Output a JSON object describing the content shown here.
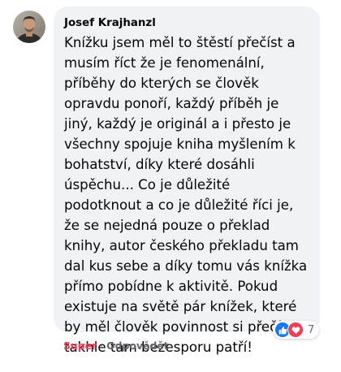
{
  "comment": {
    "author": "Josef Krajhanzl",
    "text_lines": [
      "Knížku jsem měl to štěstí přečíst a",
      "musím říct že je fenomenální,",
      "příběhy do kterých se člověk",
      "opravdu ponoří, každý příběh je",
      "jiný, každý je originál a i přesto je",
      "všechny spojuje kniha myšlením k",
      "bohatství, díky které dosáhli",
      "úspěchu... Co je důležité",
      "podotknout a co je důležité říci je,",
      "že se nejedná pouze o překlad",
      "knihy, autor českého překladu tam",
      "dal kus sebe a díky tomu vás knížka",
      "přímo pobídne k aktivitě. Pokud",
      "existuje na světě pár knížek, které",
      "by měl člověk povinnost si přečíst,",
      "takhle tam bezesporu patří!"
    ],
    "reactions": {
      "icons": [
        "like-icon",
        "love-icon"
      ],
      "count": "7",
      "colors": {
        "like": "#1877f2",
        "love": "#f33e58"
      }
    },
    "actions": {
      "reaction_label": "Super",
      "separator": "·",
      "reply_label": "Odpovědět"
    }
  },
  "colors": {
    "bubble_bg": "#f0f2f5",
    "text": "#050505",
    "secondary_text": "#65676b",
    "super_red": "#f33e58"
  }
}
